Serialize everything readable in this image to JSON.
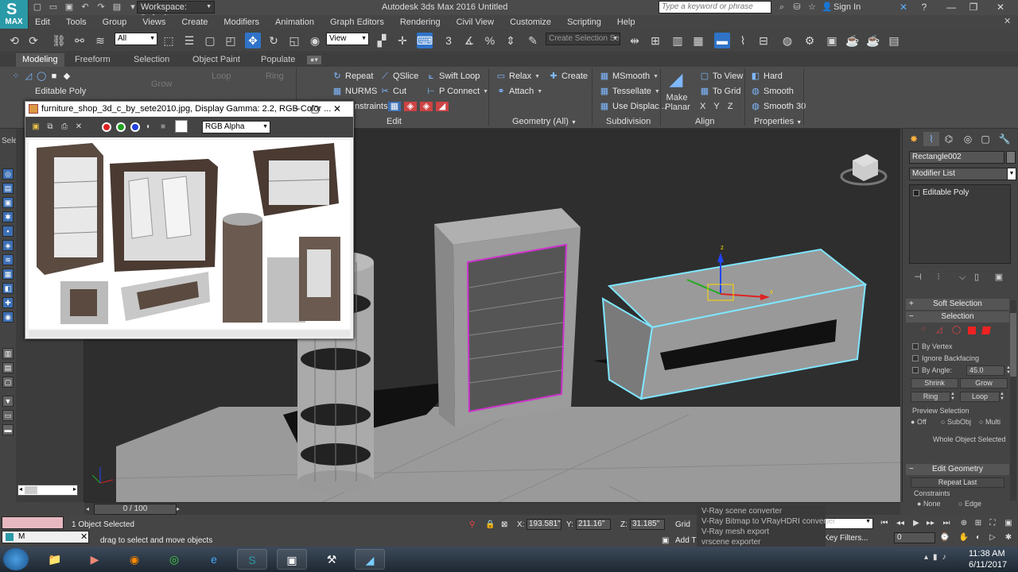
{
  "titlebar": {
    "logo_text": "MAX",
    "workspace": "Workspace: Default",
    "app_title": "Autodesk 3ds Max 2016    Untitled",
    "search_placeholder": "Type a keyword or phrase",
    "sign_in": "Sign In",
    "help_icon": "?"
  },
  "menu": [
    "Edit",
    "Tools",
    "Group",
    "Views",
    "Create",
    "Modifiers",
    "Animation",
    "Graph Editors",
    "Rendering",
    "Civil View",
    "Customize",
    "Scripting",
    "Help"
  ],
  "main_toolbar": {
    "selection_filter": "All",
    "ref_coord": "View",
    "named_selection_placeholder": "Create Selection Se"
  },
  "ribbon_tabs": [
    "Modeling",
    "Freeform",
    "Selection",
    "Object Paint",
    "Populate"
  ],
  "ribbon": {
    "editable_poly": "Editable Poly",
    "grow": "Grow",
    "loop": "Loop",
    "ring": "Ring",
    "edit_buttons": [
      "Repeat",
      "QSlice",
      "Swift Loop",
      "NURMS",
      "Cut",
      "P Connect"
    ],
    "constraints": "nstraints:",
    "edit_title": "Edit",
    "geometry_buttons": [
      "Relax",
      "Create",
      "Attach"
    ],
    "geometry_title": "Geometry (All)",
    "subdivision_buttons": [
      "MSmooth",
      "Tessellate",
      "Use Displac..."
    ],
    "subdivision_title": "Subdivision",
    "make_planar": "Make Planar",
    "align_buttons": [
      "To View",
      "To Grid"
    ],
    "align_xyz": [
      "X",
      "Y",
      "Z"
    ],
    "align_title": "Align",
    "properties_buttons": [
      "Hard",
      "Smooth",
      "Smooth 30"
    ],
    "properties_title": "Properties"
  },
  "left_panel": {
    "label": "Sele"
  },
  "image_window": {
    "title": "furniture_shop_3d_c_by_sete2010.jpg, Display Gamma: 2.2, RGB Color ...",
    "channel": "RGB Alpha"
  },
  "command_panel": {
    "object_name": "Rectangle002",
    "modifier_list": "Modifier List",
    "stack_item": "Editable Poly",
    "soft_selection": "Soft Selection",
    "selection": "Selection",
    "by_vertex": "By Vertex",
    "ignore_backfacing": "Ignore Backfacing",
    "by_angle": "By Angle:",
    "angle_value": "45.0",
    "shrink": "Shrink",
    "grow": "Grow",
    "ring": "Ring",
    "loop": "Loop",
    "preview_selection": "Preview Selection",
    "preview_options": [
      "Off",
      "SubObj",
      "Multi"
    ],
    "whole_object": "Whole Object Selected",
    "edit_geometry": "Edit Geometry",
    "repeat_last": "Repeat Last",
    "constraints": "Constraints",
    "constraint_options": [
      "None",
      "Edge"
    ]
  },
  "time_slider": {
    "frame": "0 / 100"
  },
  "status": {
    "selected": "1 Object Selected",
    "prompt": "drag to select and move objects",
    "x_label": "X:",
    "x_value": "193.581\"",
    "y_label": "Y:",
    "y_value": "211.16\"",
    "z_label": "Z:",
    "z_value": "31.185\"",
    "grid": "Grid",
    "add": "Add T",
    "key_filters": "Key Filters...",
    "frame_value": "0",
    "maxscript_label": "M"
  },
  "vray_menu": [
    "V-Ray scene converter",
    "V-Ray Bitmap to VRayHDRI converter",
    "V-Ray mesh export",
    "vrscene exporter"
  ],
  "taskbar": {
    "time": "11:38 AM",
    "date": "6/11/2017"
  },
  "colors": {
    "accent": "#2f73c8",
    "selection_highlight": "#7fe6ff",
    "frame_magenta": "#cc33cc"
  }
}
